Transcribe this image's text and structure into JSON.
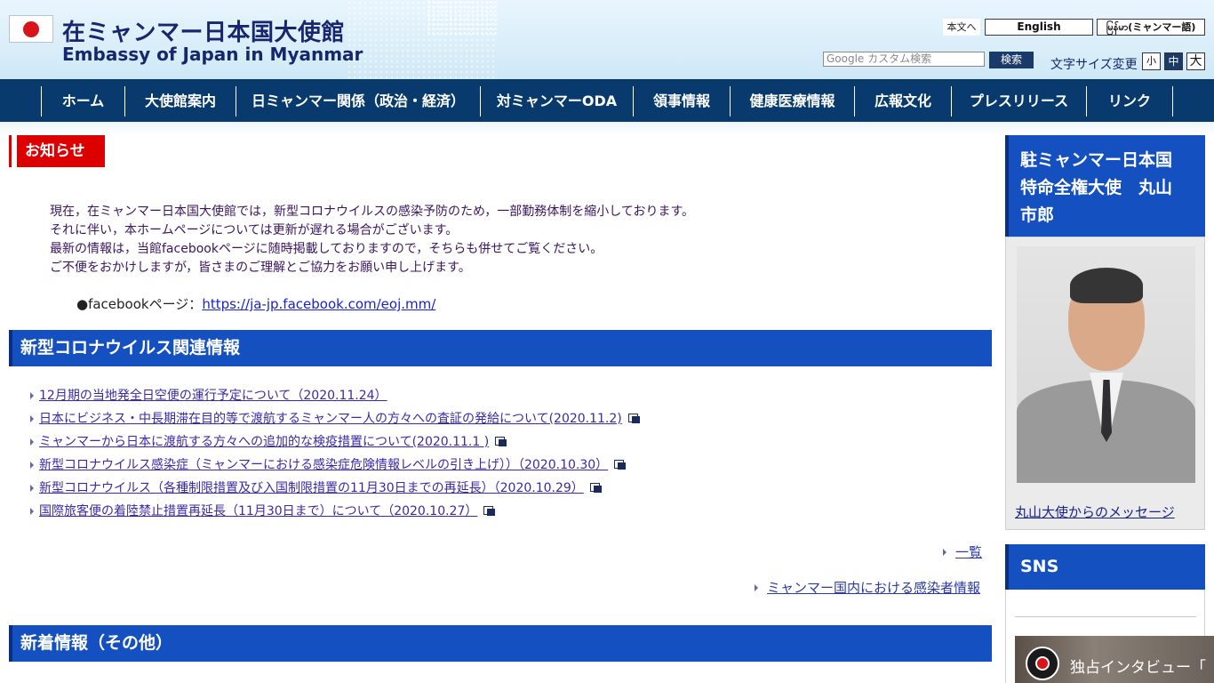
{
  "header": {
    "title_ja": "在ミャンマー日本国大使館",
    "title_en": "Embassy of Japan in Myanmar",
    "honbun_label": "本文へ",
    "lang_en": "English",
    "lang_mm": "မြန်မာ(ミャンマー語)",
    "search_placeholder": "Google カスタム検索",
    "search_button": "検索",
    "fontsize_label": "文字サイズ変更",
    "fontsize_small": "小",
    "fontsize_mid": "中",
    "fontsize_large": "大"
  },
  "nav": [
    "ホーム",
    "大使館案内",
    "日ミャンマー関係（政治・経済）",
    "対ミャンマーODA",
    "領事情報",
    "健康医療情報",
    "広報文化",
    "プレスリリース",
    "リンク"
  ],
  "notice": {
    "heading": "お知らせ",
    "lines": [
      "現在，在ミャンマー日本国大使館では，新型コロナウイルスの感染予防のため，一部勤務体制を縮小しております。",
      "それに伴い，本ホームページについては更新が遅れる場合がございます。",
      "最新の情報は，当館facebookページに随時掲載しておりますので，そちらも併せてご覧ください。",
      "ご不便をおかけしますが，皆さまのご理解とご協力をお願い申し上げます。"
    ],
    "fb_label": "●facebookページ：",
    "fb_link": "https://ja-jp.facebook.com/eoj.mm/"
  },
  "covid": {
    "heading": "新型コロナウイルス関連情報",
    "items": [
      {
        "text": "12月期の当地発全日空便の運行予定について（2020.11.24）",
        "external": false
      },
      {
        "text": "日本にビジネス・中長期滞在目的等で渡航するミャンマー人の方々への査証の発給について(2020.11.2)",
        "external": true
      },
      {
        "text": "ミャンマーから日本に渡航する方々への追加的な検疫措置について(2020.11.1 )",
        "external": true
      },
      {
        "text": "新型コロナウイルス感染症（ミャンマーにおける感染症危険情報レベルの引き上げ））（2020.10.30）",
        "external": true
      },
      {
        "text": "新型コロナウイルス（各種制限措置及び入国制限措置の11月30日までの再延長）（2020.10.29）",
        "external": true
      },
      {
        "text": "国際旅客便の着陸禁止措置再延長（11月30日まで）について（2020.10.27）",
        "external": true
      }
    ],
    "more_label": "一覧",
    "infected_label": "ミャンマー国内における感染者情報"
  },
  "latest": {
    "heading": "新着情報（その他）"
  },
  "sidebar": {
    "ambassador_line1": "駐ミャンマー日本国",
    "ambassador_line2": "特命全権大使　丸山",
    "ambassador_line3": "市郎",
    "message_link": "丸山大使からのメッセージ",
    "sns_heading": "SNS",
    "video_title": "独占インタビュー「"
  }
}
